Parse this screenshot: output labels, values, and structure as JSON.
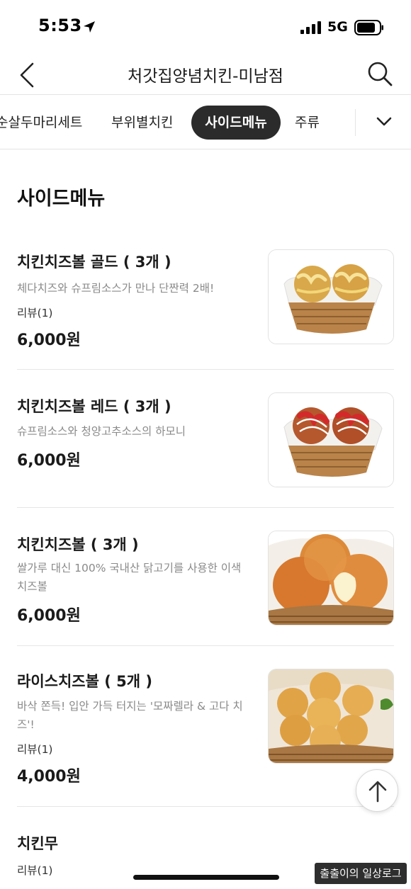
{
  "status_bar": {
    "time": "5:53",
    "network": "5G"
  },
  "nav": {
    "title": "처갓집양념치킨-미남점",
    "back_icon": "chevron-left-icon",
    "search_icon": "search-icon"
  },
  "categories": {
    "tabs": [
      "순살두마리세트",
      "부위별치킨",
      "사이드메뉴",
      "주류"
    ],
    "selected": "사이드메뉴",
    "more_icon": "chevron-down-icon",
    "active_color": "#2b2b2b"
  },
  "section": {
    "title": "사이드메뉴"
  },
  "items": [
    {
      "name": "치킨치즈볼 골드 ( 3개 )",
      "desc": "체다치즈와 슈프림소스가 만나 단짠력 2배!",
      "review": "리뷰(1)",
      "price": "6,000원"
    },
    {
      "name": "치킨치즈볼 레드 ( 3개 )",
      "desc": "슈프림소스와 청양고추소스의 하모니",
      "price": "6,000원"
    },
    {
      "name": "치킨치즈볼 ( 3개 )",
      "desc": "쌀가루 대신 100% 국내산 닭고기를 사용한 이색 치즈볼",
      "price": "6,000원"
    },
    {
      "name": "라이스치즈볼 ( 5개 )",
      "desc": "바삭 쫀득! 입안 가득 터지는 '모짜렐라 & 고다 치즈'!",
      "review": "리뷰(1)",
      "price": "4,000원"
    },
    {
      "name": "치킨무",
      "review": "리뷰(1)"
    }
  ],
  "watermark": "출출이의 일상로그"
}
